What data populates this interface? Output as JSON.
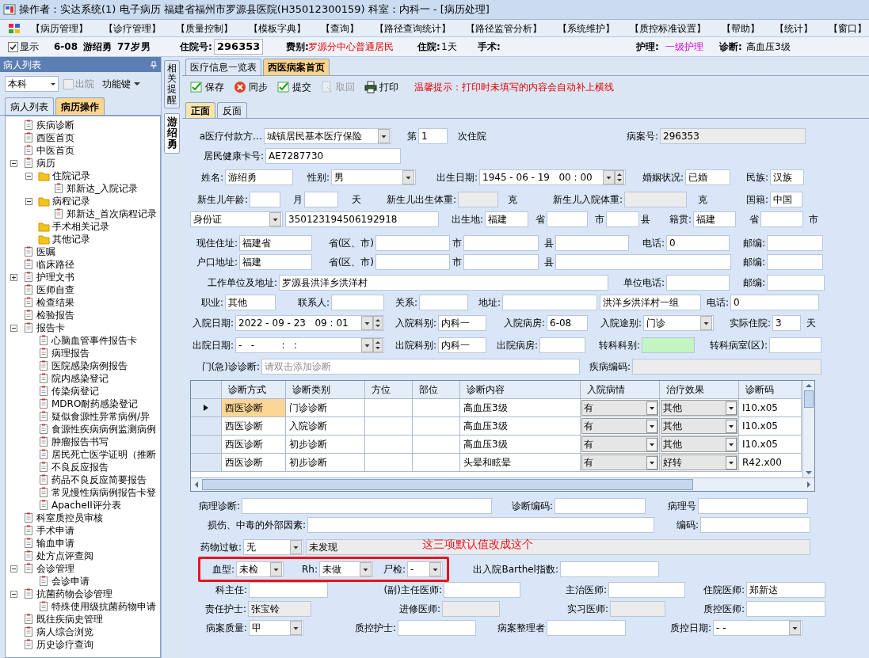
{
  "window": {
    "title": "操作者：实达系统(1) 电子病历  福建省福州市罗源县医院(H35012300159)  科室：内科一 - [病历处理]"
  },
  "menu": [
    "【病历管理】",
    "【诊疗管理】",
    "【质量控制】",
    "【模板字典】",
    "【查询】",
    "【路径查询统计】",
    "【路径监管分析】",
    "【系统维护】",
    "【质控标准设置】",
    "【帮助】",
    "【统计】",
    "【窗口】"
  ],
  "patient_bar": {
    "show": {
      "label": "显示",
      "checked": true
    },
    "bed": "6-08",
    "name": "游绍勇",
    "age": "77岁",
    "sex": "男",
    "inpatient_no": {
      "label": "住院号:",
      "value": "296353"
    },
    "fee_type": {
      "label": "费别:",
      "value": "罗源分中心普通居民"
    },
    "stay": {
      "label": "住院:",
      "value": "1天"
    },
    "surgery": {
      "label": "手术:"
    },
    "nursing": {
      "label": "护理:",
      "value": "一级护理"
    },
    "diagnosis": {
      "label": "诊断:",
      "value": "高血压3级"
    }
  },
  "sidebar": {
    "title": "病人列表",
    "department": "本科",
    "discharged": {
      "label": "出院",
      "checked": false,
      "disabled": true
    },
    "function_key": "功能键",
    "tabs": [
      {
        "label": "病人列表",
        "selected": false
      },
      {
        "label": "病历操作",
        "selected": true
      }
    ],
    "tree": [
      {
        "label": "疾病诊断",
        "kind": "document"
      },
      {
        "label": "西医首页",
        "kind": "document"
      },
      {
        "label": "中医首页",
        "kind": "document"
      },
      {
        "label": "病历",
        "kind": "document",
        "expanded": true,
        "children": [
          {
            "label": "住院记录",
            "kind": "folder",
            "expanded": true,
            "children": [
              {
                "label": "郑新达_入院记录",
                "kind": "document"
              }
            ]
          },
          {
            "label": "病程记录",
            "kind": "folder",
            "expanded": true,
            "children": [
              {
                "label": "郑新达_首次病程记录",
                "kind": "document"
              }
            ]
          },
          {
            "label": "手术相关记录",
            "kind": "folder"
          },
          {
            "label": "其他记录",
            "kind": "folder"
          }
        ]
      },
      {
        "label": "医嘱",
        "kind": "document"
      },
      {
        "label": "临床路径",
        "kind": "document"
      },
      {
        "label": "护理文书",
        "kind": "document",
        "expanded": false
      },
      {
        "label": "医师自查",
        "kind": "document"
      },
      {
        "label": "检查结果",
        "kind": "document"
      },
      {
        "label": "检验报告",
        "kind": "document"
      },
      {
        "label": "报告卡",
        "kind": "document",
        "expanded": true,
        "children": [
          {
            "label": "心脑血管事件报告卡",
            "kind": "document"
          },
          {
            "label": "病理报告",
            "kind": "document"
          },
          {
            "label": "医院感染病例报告",
            "kind": "document"
          },
          {
            "label": "院内感染登记",
            "kind": "document"
          },
          {
            "label": "传染病登记",
            "kind": "document"
          },
          {
            "label": "MDRO耐药感染登记",
            "kind": "document"
          },
          {
            "label": "疑似食源性异常病例/异",
            "kind": "document"
          },
          {
            "label": "食源性疾病病例监测病例",
            "kind": "document"
          },
          {
            "label": "肿瘤报告书写",
            "kind": "document"
          },
          {
            "label": "居民死亡医学证明（推断",
            "kind": "document"
          },
          {
            "label": "不良反应报告",
            "kind": "document"
          },
          {
            "label": "药品不良反应简要报告",
            "kind": "document"
          },
          {
            "label": "常见慢性病病例报告卡登",
            "kind": "document"
          },
          {
            "label": "ApacheII评分表",
            "kind": "document"
          }
        ]
      },
      {
        "label": "科室质控员审核",
        "kind": "document"
      },
      {
        "label": "手术申请",
        "kind": "document"
      },
      {
        "label": "输血申请",
        "kind": "document"
      },
      {
        "label": "处方点评查阅",
        "kind": "document"
      },
      {
        "label": "会诊管理",
        "kind": "document",
        "expanded": true,
        "children": [
          {
            "label": "会诊申请",
            "kind": "document"
          }
        ]
      },
      {
        "label": "抗菌药物会诊管理",
        "kind": "document",
        "expanded": true,
        "children": [
          {
            "label": "特殊使用级抗菌药物申请",
            "kind": "document"
          }
        ]
      },
      {
        "label": "既往疾病史管理",
        "kind": "document"
      },
      {
        "label": "病人综合浏览",
        "kind": "document"
      },
      {
        "label": "历史诊疗查询",
        "kind": "document"
      }
    ]
  },
  "side_tabs": [
    {
      "label": "相关提醒",
      "selected": false
    },
    {
      "label": "游绍勇",
      "selected": true
    }
  ],
  "doc_tabs": [
    {
      "label": "医疗信息一览表",
      "selected": false
    },
    {
      "label": "西医病案首页",
      "selected": true
    }
  ],
  "toolbar": {
    "buttons": [
      {
        "label": "保存",
        "disabled": false
      },
      {
        "label": "同步",
        "disabled": false
      },
      {
        "label": "提交",
        "disabled": false
      },
      {
        "label": "取回",
        "disabled": true
      },
      {
        "label": "打印",
        "disabled": false
      }
    ],
    "tip": "温馨提示：打印时未填写的内容会自动补上横线"
  },
  "page_tabs": [
    {
      "label": "正面",
      "selected": true
    },
    {
      "label": "反面",
      "selected": false
    }
  ],
  "form": {
    "upper_rows": [
      {
        "items": [
          {
            "kind": "label",
            "text": "a医疗付款方…"
          },
          {
            "kind": "select",
            "value": "城镇居民基本医疗保险"
          },
          {
            "kind": "label",
            "text": "第"
          },
          {
            "kind": "input",
            "value": "1"
          },
          {
            "kind": "label",
            "text": "次住院"
          },
          {
            "kind": "label",
            "text": "病案号:"
          },
          {
            "kind": "grey_input",
            "value": "296353"
          }
        ]
      },
      {
        "items": [
          {
            "kind": "label",
            "text": "居民健康卡号:"
          },
          {
            "kind": "input",
            "value": "AE7287730"
          }
        ]
      },
      {
        "items": [
          {
            "kind": "label",
            "text": "姓名:"
          },
          {
            "kind": "input",
            "value": "游绍勇"
          },
          {
            "kind": "label",
            "text": "性别:"
          },
          {
            "kind": "select",
            "value": "男"
          },
          {
            "kind": "label",
            "text": "出生日期:"
          },
          {
            "kind": "datetime",
            "value": "1945 - 06 - 19   00 : 00"
          },
          {
            "kind": "label",
            "text": "婚姻状况:"
          },
          {
            "kind": "input",
            "value": "已婚"
          },
          {
            "kind": "label",
            "text": "民族:"
          },
          {
            "kind": "input",
            "value": "汉族"
          }
        ]
      },
      {
        "items": [
          {
            "kind": "label",
            "text": "新生儿年龄:"
          },
          {
            "kind": "input"
          },
          {
            "kind": "label",
            "text": "月"
          },
          {
            "kind": "input"
          },
          {
            "kind": "label",
            "text": "天"
          },
          {
            "kind": "label",
            "text": "新生儿出生体重:"
          },
          {
            "kind": "grey_input"
          },
          {
            "kind": "label",
            "text": "克"
          },
          {
            "kind": "label",
            "text": "新生儿入院体重:"
          },
          {
            "kind": "grey_input"
          },
          {
            "kind": "label",
            "text": "克"
          },
          {
            "kind": "label",
            "text": "国籍:"
          },
          {
            "kind": "input",
            "value": "中国"
          }
        ]
      },
      {
        "items": [
          {
            "kind": "select",
            "value": "身份证"
          },
          {
            "kind": "input",
            "value": "350123194506192918"
          },
          {
            "kind": "label",
            "text": "出生地:"
          },
          {
            "kind": "input",
            "value": "福建"
          },
          {
            "kind": "label",
            "text": "省"
          },
          {
            "kind": "input"
          },
          {
            "kind": "label",
            "text": "市"
          },
          {
            "kind": "input"
          },
          {
            "kind": "label",
            "text": "县"
          },
          {
            "kind": "label",
            "text": "籍贯:"
          },
          {
            "kind": "input",
            "value": "福建"
          },
          {
            "kind": "label",
            "text": "省"
          },
          {
            "kind": "input"
          },
          {
            "kind": "label",
            "text": "市"
          }
        ]
      },
      {
        "items": [
          {
            "kind": "label",
            "text": "现住住址:"
          },
          {
            "kind": "input",
            "value": "福建省"
          },
          {
            "kind": "label",
            "text": "省(区、市)"
          },
          {
            "kind": "input"
          },
          {
            "kind": "label",
            "text": "市"
          },
          {
            "kind": "input"
          },
          {
            "kind": "label",
            "text": "县"
          },
          {
            "kind": "input"
          },
          {
            "kind": "label",
            "text": "电话:"
          },
          {
            "kind": "input",
            "value": "0"
          },
          {
            "kind": "label",
            "text": "邮编:"
          },
          {
            "kind": "input"
          }
        ]
      },
      {
        "items": [
          {
            "kind": "label",
            "text": "户口地址:"
          },
          {
            "kind": "input",
            "value": "福建"
          },
          {
            "kind": "label",
            "text": "省(区、市)"
          },
          {
            "kind": "input"
          },
          {
            "kind": "label",
            "text": "市"
          },
          {
            "kind": "input"
          },
          {
            "kind": "label",
            "text": "县"
          },
          {
            "kind": "input"
          },
          {
            "kind": "label",
            "text": "邮编:"
          },
          {
            "kind": "input"
          }
        ]
      },
      {
        "items": [
          {
            "kind": "label",
            "text": "工作单位及地址:"
          },
          {
            "kind": "input",
            "value": "罗源县洪洋乡洪洋村"
          },
          {
            "kind": "label",
            "text": "单位电话:"
          },
          {
            "kind": "input"
          },
          {
            "kind": "label",
            "text": "邮编:"
          },
          {
            "kind": "input"
          }
        ]
      },
      {
        "items": [
          {
            "kind": "label",
            "text": "职业:"
          },
          {
            "kind": "input",
            "value": "其他"
          },
          {
            "kind": "label",
            "text": "联系人:"
          },
          {
            "kind": "input"
          },
          {
            "kind": "label",
            "text": "关系:"
          },
          {
            "kind": "input"
          },
          {
            "kind": "label",
            "text": "地址:"
          },
          {
            "kind": "input"
          },
          {
            "kind": "input",
            "value": "洪洋乡洪洋村一组"
          },
          {
            "kind": "label",
            "text": "电话:"
          },
          {
            "kind": "input",
            "value": "0"
          }
        ]
      },
      {
        "items": [
          {
            "kind": "label",
            "text": "入院日期:"
          },
          {
            "kind": "datetime",
            "value": "2022 - 09 - 23   09 : 01"
          },
          {
            "kind": "label",
            "text": "入院科别:"
          },
          {
            "kind": "input",
            "value": "内科一"
          },
          {
            "kind": "label",
            "text": "入院病房:"
          },
          {
            "kind": "input",
            "value": "6-08"
          },
          {
            "kind": "label",
            "text": "入院途别:"
          },
          {
            "kind": "select",
            "value": "门诊"
          },
          {
            "kind": "label",
            "text": "实际住院:"
          },
          {
            "kind": "input",
            "value": "3"
          },
          {
            "kind": "label",
            "text": "天"
          }
        ]
      },
      {
        "items": [
          {
            "kind": "label",
            "text": "出院日期:"
          },
          {
            "kind": "datetime",
            "value": "-   -         :   :"
          },
          {
            "kind": "label",
            "text": "出院科别:"
          },
          {
            "kind": "input",
            "value": "内科一"
          },
          {
            "kind": "label",
            "text": "出院病房:"
          },
          {
            "kind": "input"
          },
          {
            "kind": "label",
            "text": "转科科别:"
          },
          {
            "kind": "green_input"
          },
          {
            "kind": "label",
            "text": "转科病室(区):"
          },
          {
            "kind": "input"
          }
        ]
      },
      {
        "items": [
          {
            "kind": "label",
            "text": "门(急)诊诊断:"
          },
          {
            "kind": "input",
            "placeholder": "请双击添加诊断"
          },
          {
            "kind": "label",
            "text": "疾病编码:"
          },
          {
            "kind": "grey_input"
          }
        ]
      }
    ],
    "diagnosis_table": {
      "columns": [
        "诊断方式",
        "诊断类别",
        "方位",
        "部位",
        "诊断内容",
        "入院病情",
        "治疗效果",
        "诊断码"
      ],
      "rows": [
        {
          "selected": true,
          "method": "西医诊断",
          "category": "门诊诊断",
          "content": "高血压3级",
          "admission_condition": "有",
          "outcome": "其他",
          "code": "I10.x05"
        },
        {
          "selected": false,
          "method": "西医诊断",
          "category": "入院诊断",
          "content": "高血压3级",
          "admission_condition": "有",
          "outcome": "其他",
          "code": "I10.x05"
        },
        {
          "selected": false,
          "method": "西医诊断",
          "category": "初步诊断",
          "content": "高血压3级",
          "admission_condition": "有",
          "outcome": "其他",
          "code": "I10.x05"
        },
        {
          "selected": false,
          "method": "西医诊断",
          "category": "初步诊断",
          "content": "头晕和眩晕",
          "admission_condition": "有",
          "outcome": "好转",
          "code": "R42.x00"
        }
      ]
    },
    "annotation": "这三项默认值改成这个",
    "lower_rows": [
      {
        "items": [
          {
            "kind": "label",
            "text": "病理诊断:"
          },
          {
            "kind": "input"
          },
          {
            "kind": "label",
            "text": "诊断编码:"
          },
          {
            "kind": "input"
          },
          {
            "kind": "label",
            "text": "病理号"
          },
          {
            "kind": "input"
          }
        ]
      },
      {
        "items": [
          {
            "kind": "label",
            "text": "损伤、中毒的外部因素:"
          },
          {
            "kind": "input"
          },
          {
            "kind": "label",
            "text": "编码:"
          },
          {
            "kind": "input"
          }
        ]
      },
      {
        "items": [
          {
            "kind": "label",
            "text": "药物过敏:"
          },
          {
            "kind": "select",
            "value": "无"
          },
          {
            "kind": "grey_input",
            "value": "未发现"
          }
        ]
      },
      {
        "boxed_items": [
          {
            "kind": "label",
            "text": "血型:"
          },
          {
            "kind": "select",
            "value": "未检"
          },
          {
            "kind": "label",
            "text": "Rh:"
          },
          {
            "kind": "select",
            "value": "未做"
          },
          {
            "kind": "label",
            "text": "尸检:"
          },
          {
            "kind": "select",
            "value": "-"
          }
        ],
        "items": [
          {
            "kind": "label",
            "text": "出入院Barthel指数:"
          },
          {
            "kind": "input"
          }
        ]
      },
      {
        "items": [
          {
            "kind": "label",
            "text": "科主任:"
          },
          {
            "kind": "input"
          },
          {
            "kind": "label",
            "text": "(副)主任医师:"
          },
          {
            "kind": "input"
          },
          {
            "kind": "label",
            "text": "主治医师:"
          },
          {
            "kind": "input"
          },
          {
            "kind": "label",
            "text": "住院医师:"
          },
          {
            "kind": "input",
            "value": "郑新达"
          }
        ]
      },
      {
        "items": [
          {
            "kind": "label",
            "text": "责任护士:"
          },
          {
            "kind": "grey_input",
            "value": "张宝铃"
          },
          {
            "kind": "label",
            "text": "进修医师:"
          },
          {
            "kind": "grey_input"
          },
          {
            "kind": "label",
            "text": "实习医师:"
          },
          {
            "kind": "grey_input"
          },
          {
            "kind": "label",
            "text": "质控医师:"
          },
          {
            "kind": "input"
          }
        ]
      },
      {
        "items": [
          {
            "kind": "label",
            "text": "病案质量:"
          },
          {
            "kind": "select",
            "value": "甲"
          },
          {
            "kind": "label",
            "text": "质控护士:"
          },
          {
            "kind": "input"
          },
          {
            "kind": "label",
            "text": "病案整理者"
          },
          {
            "kind": "input"
          },
          {
            "kind": "label",
            "text": "质控日期:"
          },
          {
            "kind": "select",
            "value": "-   -"
          }
        ]
      }
    ]
  }
}
